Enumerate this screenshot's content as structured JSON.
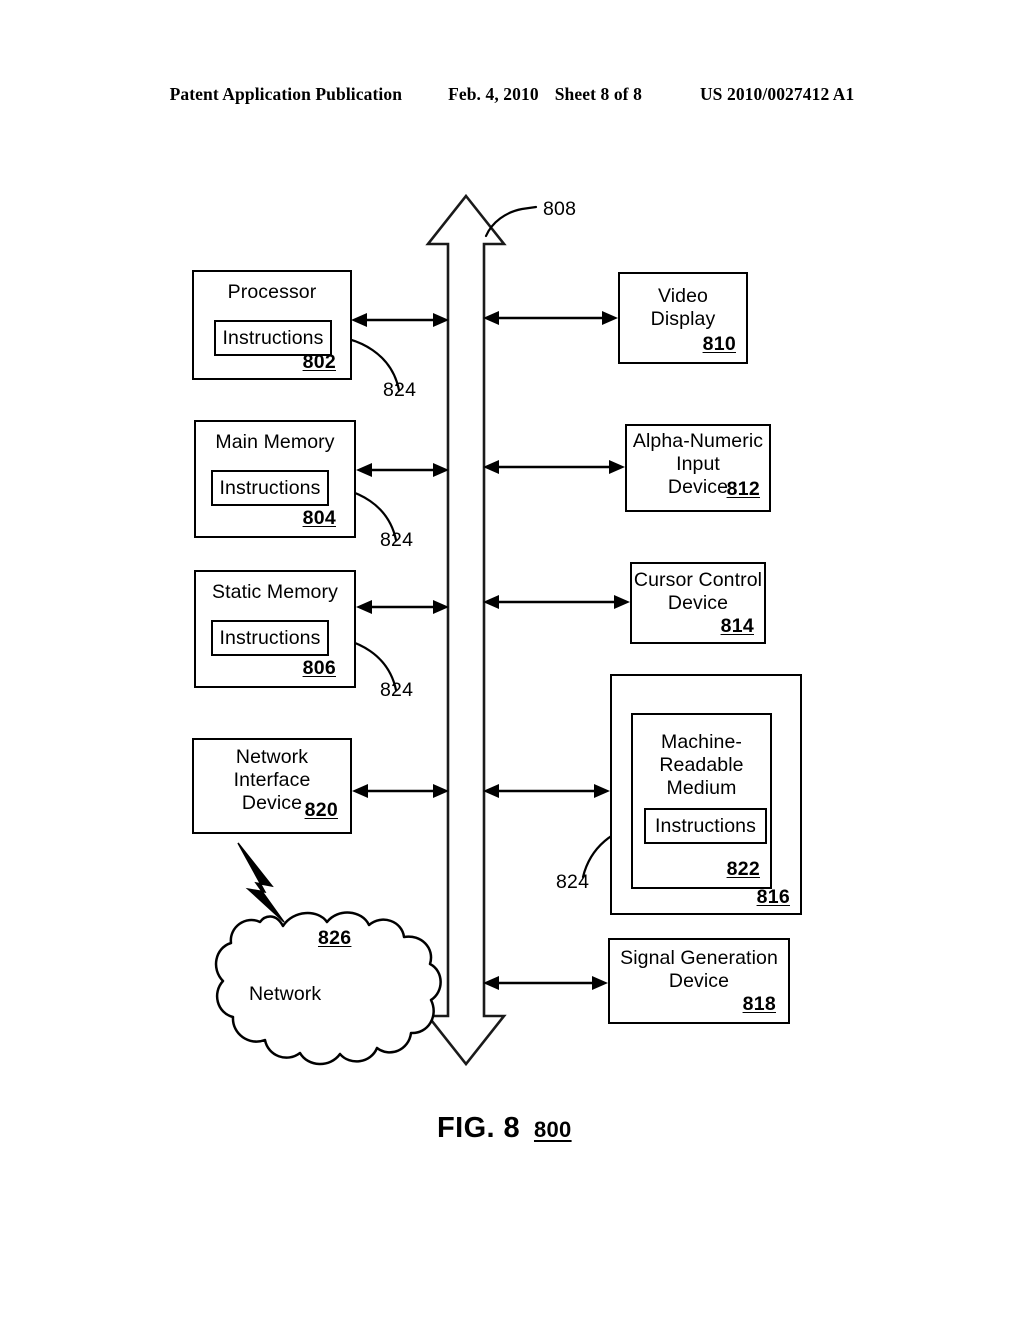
{
  "header": {
    "publication": "Patent Application Publication",
    "date": "Feb. 4, 2010",
    "sheet": "Sheet 8 of 8",
    "patent_number": "US 2010/0027412 A1"
  },
  "figure": {
    "caption_label": "FIG. 8",
    "caption_ref": "800",
    "bus": {
      "name": "system-bus",
      "ref": "808"
    },
    "left_blocks": [
      {
        "title": "Processor",
        "ref": "802",
        "inner_label": "Instructions",
        "lead_ref": "824"
      },
      {
        "title": "Main Memory",
        "ref": "804",
        "inner_label": "Instructions",
        "lead_ref": "824"
      },
      {
        "title": "Static Memory",
        "ref": "806",
        "inner_label": "Instructions",
        "lead_ref": "824"
      },
      {
        "title": "Network\nInterface\nDevice",
        "title_lines": [
          "Network",
          "Interface",
          "Device"
        ],
        "ref": "820"
      }
    ],
    "right_blocks": [
      {
        "title_lines": [
          "Video",
          "Display"
        ],
        "ref": "810"
      },
      {
        "title_lines": [
          "Alpha-Numeric",
          "Input",
          "Device"
        ],
        "ref": "812"
      },
      {
        "title_lines": [
          "Cursor Control",
          "Device"
        ],
        "ref": "814"
      },
      {
        "title_lines": [
          "Machine-",
          "Readable",
          "Medium"
        ],
        "ref": "816",
        "inner_ref": "822",
        "inner_label": "Instructions",
        "lead_ref": "824"
      },
      {
        "title_lines": [
          "Signal Generation",
          "Device"
        ],
        "ref": "818"
      }
    ],
    "network": {
      "label": "Network",
      "ref": "826"
    }
  },
  "colors": {
    "ink": "#000000",
    "paper": "#ffffff"
  }
}
